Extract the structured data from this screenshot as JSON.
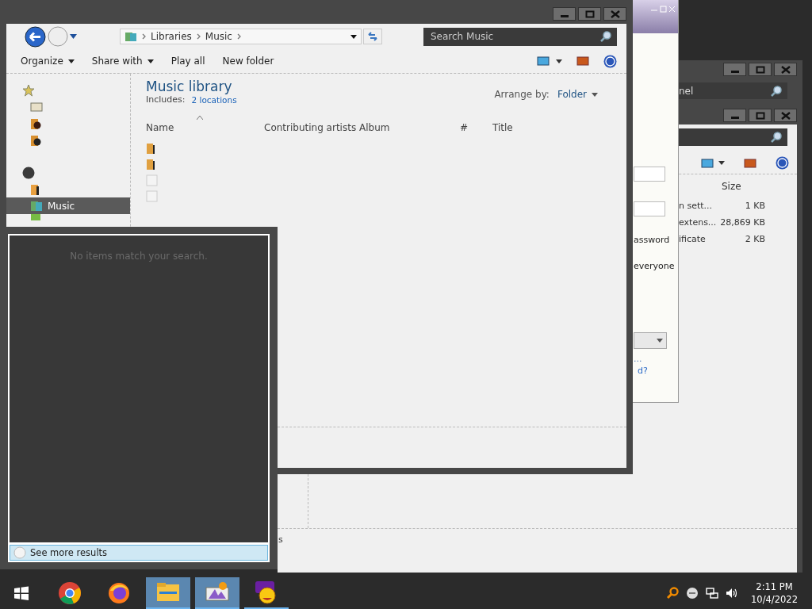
{
  "explorer": {
    "breadcrumb": [
      "Libraries",
      "Music"
    ],
    "search_placeholder": "Search Music",
    "toolbar": [
      {
        "label": "Organize",
        "dropdown": true
      },
      {
        "label": "Share with",
        "dropdown": true
      },
      {
        "label": "Play all",
        "dropdown": false
      },
      {
        "label": "New folder",
        "dropdown": false
      }
    ],
    "sidebar": {
      "items": [
        {
          "kind": "star",
          "group": true,
          "selected": false
        },
        {
          "kind": "desktop",
          "group": false,
          "selected": false
        },
        {
          "kind": "downloads",
          "group": false,
          "selected": false
        },
        {
          "kind": "recent",
          "group": false,
          "selected": false
        },
        {
          "kind": "libraries",
          "group": true,
          "selected": false
        },
        {
          "kind": "documents",
          "group": false,
          "selected": false
        },
        {
          "kind": "music",
          "group": false,
          "label": "Music",
          "selected": true
        },
        {
          "kind": "pictures",
          "group": false,
          "selected": false
        }
      ]
    },
    "library": {
      "title": "Music library",
      "includes_label": "Includes:",
      "includes_link": "2 locations",
      "arrange_label": "Arrange by:",
      "arrange_value": "Folder"
    },
    "columns": [
      "Name",
      "Contributing artists",
      "Album",
      "#",
      "Title"
    ],
    "files": [
      {
        "kind": "folder"
      },
      {
        "kind": "folder"
      },
      {
        "kind": "file"
      },
      {
        "kind": "file"
      }
    ]
  },
  "search_popup": {
    "message": "No items match your search.",
    "see_more": "See more results"
  },
  "back_window": {
    "search_value": "nel",
    "status_text": "s"
  },
  "files_window": {
    "column": "Size",
    "rows": [
      {
        "type": "n sett...",
        "size": "1 KB"
      },
      {
        "type": "extens...",
        "size": "28,869 KB"
      },
      {
        "type": "ificate",
        "size": "2 KB"
      }
    ]
  },
  "dialog": {
    "texts": [
      "assword",
      "everyone"
    ],
    "ellipsis": "...",
    "link": "d?"
  },
  "taskbar": {
    "apps": [
      {
        "kind": "chrome",
        "active": false,
        "open": false
      },
      {
        "kind": "firefox",
        "active": false,
        "open": false
      },
      {
        "kind": "folder",
        "active": true,
        "open": true
      },
      {
        "kind": "paint",
        "active": true,
        "open": true
      },
      {
        "kind": "yahoo",
        "active": false,
        "open": true
      }
    ],
    "time": "2:11 PM",
    "date": "10/4/2022"
  }
}
